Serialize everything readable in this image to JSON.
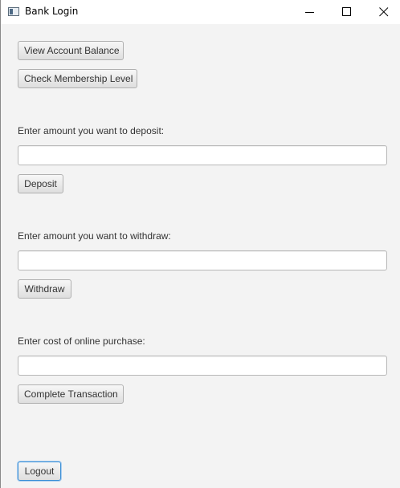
{
  "window": {
    "title": "Bank Login"
  },
  "buttons": {
    "view_balance": "View Account Balance",
    "membership": "Check Membership Level",
    "deposit": "Deposit",
    "withdraw": "Withdraw",
    "complete_transaction": "Complete Transaction",
    "logout": "Logout"
  },
  "labels": {
    "deposit_prompt": "Enter amount you want to deposit:",
    "withdraw_prompt": "Enter amount you want to withdraw:",
    "purchase_prompt": "Enter cost of online purchase:"
  },
  "inputs": {
    "deposit_value": "",
    "withdraw_value": "",
    "purchase_value": ""
  },
  "icons": {
    "app": "app-window-icon",
    "minimize": "minimize-icon",
    "maximize": "maximize-icon",
    "close": "close-icon"
  }
}
